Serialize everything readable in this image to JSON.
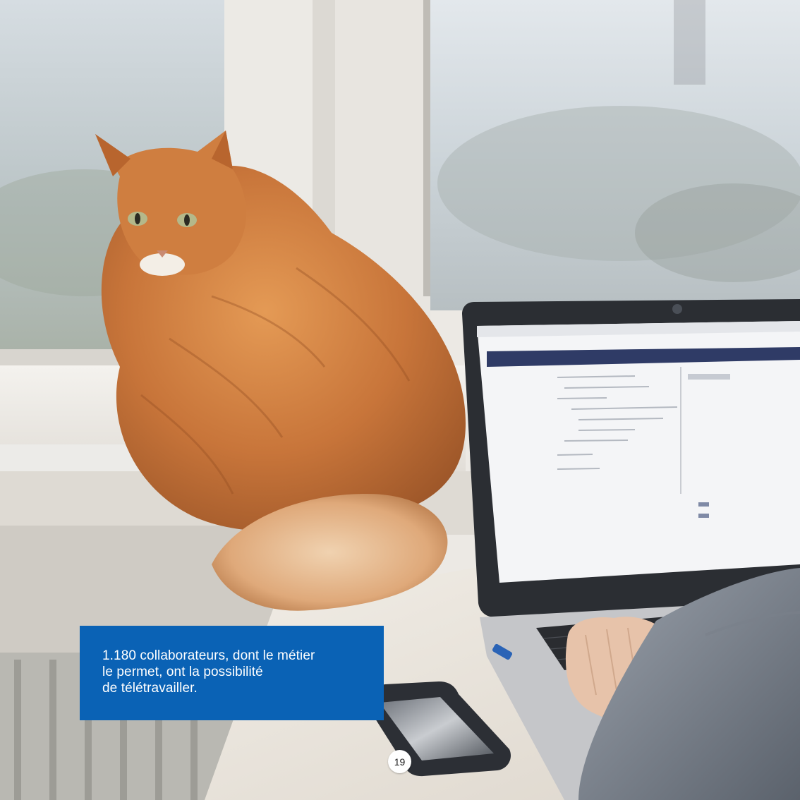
{
  "photo": {
    "subject": "photograph",
    "colors": {
      "fur": "#c8753a",
      "window_sky": "#cdd8df",
      "laptop_body": "#2b2e33",
      "screen": "#f4f5f7",
      "screen_header": "#2f3b66"
    }
  },
  "caption": {
    "text": "1.180 collaborateurs, dont le métier\nle permet, ont la possibilité\nde télétravailler.",
    "background_color": "#0a62b5"
  },
  "page_number": "19"
}
